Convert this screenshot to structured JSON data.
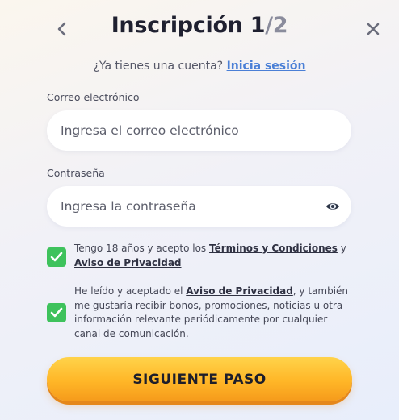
{
  "header": {
    "title_main": "Inscripción 1",
    "title_total": "/2",
    "back_icon": "chevron-left-icon",
    "close_icon": "close-icon"
  },
  "login_prompt": {
    "text": "¿Ya tienes una cuenta?",
    "link": "Inicia sesión"
  },
  "email": {
    "label": "Correo electrónico",
    "placeholder": "Ingresa el correo electrónico",
    "value": ""
  },
  "password": {
    "label": "Contraseña",
    "placeholder": "Ingresa la contraseña",
    "value": "",
    "toggle_icon": "eye-icon"
  },
  "consent_age": {
    "checked": true,
    "text_1": "Tengo 18 años y acepto los ",
    "link_1": "Términos y Condiciones",
    "text_2": " y ",
    "link_2": "Aviso de Privacidad"
  },
  "consent_marketing": {
    "checked": true,
    "text_1": "He leído y aceptado el ",
    "link_1": "Aviso de Privacidad",
    "text_2": ", y también me gustaría recibir bonos, promociones, noticias u otra información relevante periódicamente por cualquier canal de comunicación."
  },
  "submit": {
    "label": "SIGUIENTE PASO"
  },
  "colors": {
    "checkbox": "#3ec25c",
    "button_top": "#ffd34a",
    "button_bottom": "#f59a1b",
    "link": "#4a7fd6"
  }
}
